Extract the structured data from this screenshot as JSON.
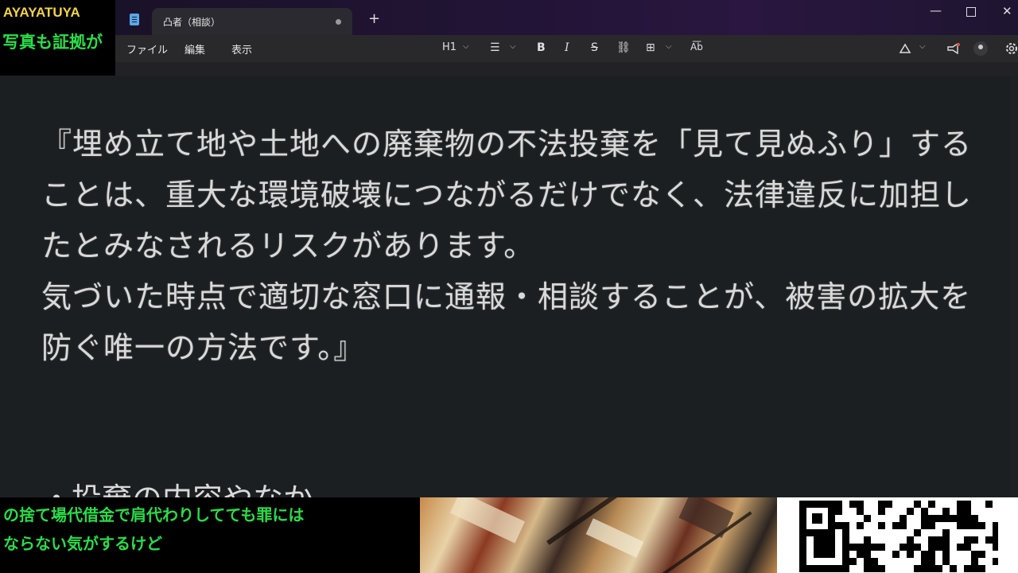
{
  "overlay_top_left": {
    "title": "AYAYATUYA",
    "marquee": "写真も証拠が"
  },
  "window": {
    "tab_title": "凸者（相談）",
    "new_tab": "+",
    "minimize": "—",
    "close": "✕"
  },
  "menu": [
    "ファイル",
    "編集",
    "表示"
  ],
  "toolbar": {
    "heading": "H1",
    "list": "☰",
    "bold": "B",
    "italic": "I",
    "strike": "S",
    "link": "⛓",
    "table": "⊞",
    "spell": "A͞b",
    "chevron": "⌵"
  },
  "document": {
    "paragraphs": [
      "『埋め立て地や土地への廃棄物の不法投棄を「見て見ぬふり」することは、重大な環境破壊につながるだけでなく、法律違反に加担したとみなされるリスクがあります。",
      "気づいた時点で適切な窓口に通報・相談することが、被害の拡大を防ぐ唯一の方法です。』"
    ],
    "cutoff_line": "・投棄の内容やなか"
  },
  "overlay_bottom_left": {
    "line1": "の捨て場代借金で肩代わりしてても罪には",
    "line2": "ならない気がするけど"
  },
  "colors": {
    "overlay_green": "#2bdc4a",
    "overlay_yellow": "#f3d44a",
    "editor_bg": "#1c1f21",
    "titlebar_purple": "#221436"
  }
}
